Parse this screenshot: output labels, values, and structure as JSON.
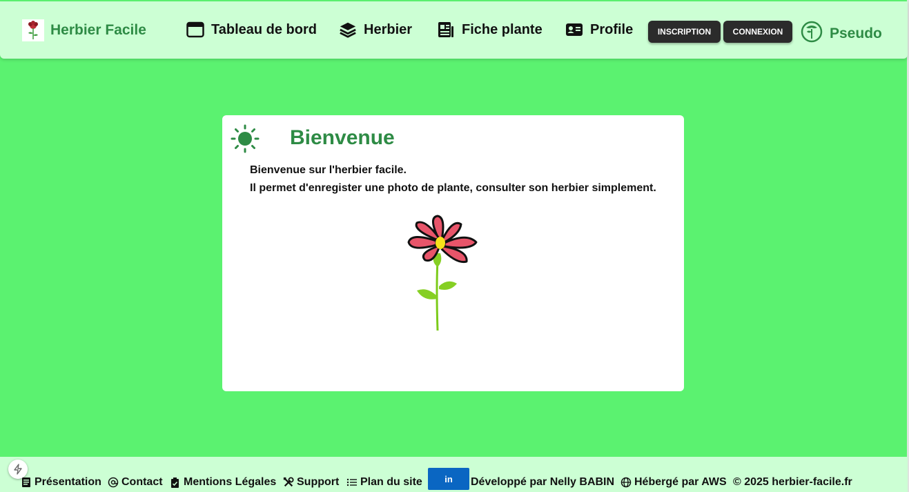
{
  "header": {
    "brand": "Herbier Facile",
    "nav": [
      {
        "label": "Tableau de bord",
        "icon": "browser-window-icon"
      },
      {
        "label": "Herbier",
        "icon": "layers-icon"
      },
      {
        "label": "Fiche plante",
        "icon": "document-list-icon"
      },
      {
        "label": "Profile",
        "icon": "id-card-icon"
      }
    ],
    "signup_label": "INSCRIPTION",
    "login_label": "CONNEXION",
    "user_label": "Pseudo"
  },
  "card": {
    "title": "Bienvenue",
    "line1": "Bienvenue sur l'herbier facile.",
    "line2": "Il permet d'enregister une photo de plante, consulter son herbier simplement."
  },
  "footer": {
    "presentation": "Présentation",
    "contact": "Contact",
    "legal": "Mentions Légales",
    "support": "Support",
    "sitemap": "Plan du site",
    "linkedin": "in",
    "developer": "Développé par Nelly BABIN",
    "hosting": "Hébergé par AWS",
    "copyright": "© 2025 herbier-facile.fr"
  },
  "colors": {
    "background": "#5bf270",
    "header_bg": "#ccffd4",
    "brand_green": "#2e8b45",
    "button_dark": "#2b2b2b",
    "linkedin_blue": "#0a66c2"
  }
}
